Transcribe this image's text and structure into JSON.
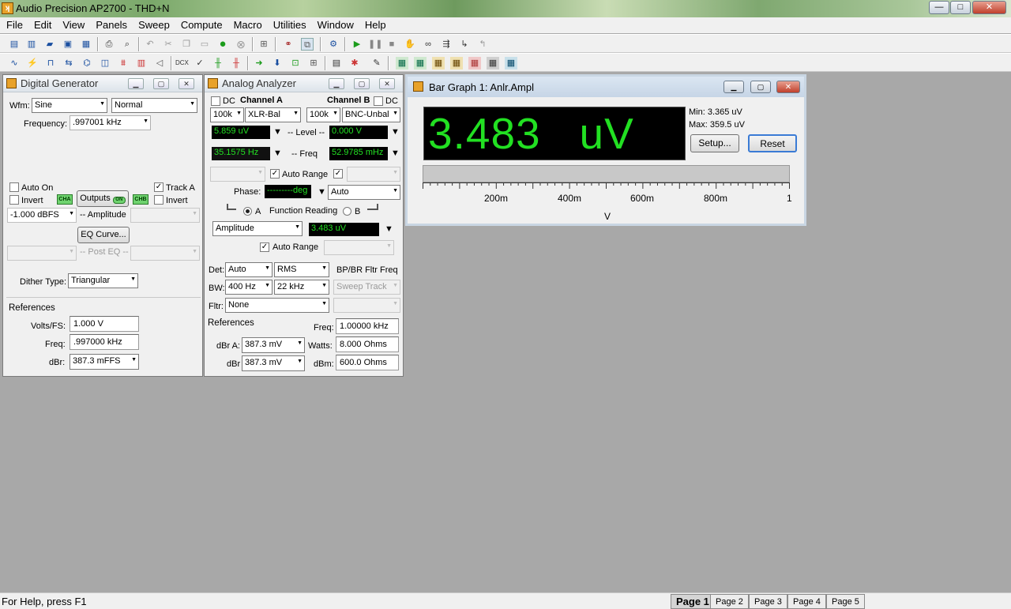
{
  "window": {
    "title": "Audio Precision AP2700 - THD+N",
    "controls": {
      "min": "—",
      "max": "□",
      "close": "✕"
    }
  },
  "menu": [
    "File",
    "Edit",
    "View",
    "Panels",
    "Sweep",
    "Compute",
    "Macro",
    "Utilities",
    "Window",
    "Help"
  ],
  "toolbar1_icons": [
    "new-icon",
    "new-test-icon",
    "open-icon",
    "save-icon",
    "save-all-icon",
    "print-icon",
    "print-preview-icon",
    "undo-icon",
    "cut-icon",
    "copy-icon",
    "paste-icon",
    "go-icon",
    "stop-circle-icon",
    "panel-icon",
    "link-icon",
    "link-toggle-icon",
    "settings-icon",
    "play-icon",
    "pause-icon",
    "stop-icon",
    "hand-icon",
    "binoculars-icon",
    "step-icon",
    "step-into-icon",
    "step-out-icon"
  ],
  "toolbar2_icons": [
    "waveform-icon",
    "analyzer-icon",
    "generator-icon",
    "switcher-icon",
    "dsp-icon",
    "sweep-icon",
    "filter-icon",
    "bargraph-icon",
    "speaker-icon",
    "dcx-icon",
    "check-icon",
    "level-icon",
    "balance-icon",
    "export-icon",
    "import-icon",
    "graph-icon",
    "table-icon",
    "meter-icon",
    "calibrate-icon",
    "notes-icon",
    "page-grid-1-icon",
    "page-grid-2-icon",
    "page-grid-3-icon",
    "page-grid-4-icon",
    "page-grid-5-icon",
    "page-grid-6-icon",
    "page-grid-7-icon"
  ],
  "gen": {
    "title": "Digital Generator",
    "wfm_label": "Wfm:",
    "wfm": "Sine",
    "wfm_mode": "Normal",
    "freq_label": "Frequency:",
    "freq": ".997001 kHz",
    "auto_on": "Auto On",
    "invert": "Invert",
    "track_a": "Track A",
    "invert_b": "Invert",
    "cha": "CHA",
    "chb": "CHB",
    "outputs": "Outputs",
    "outputs_state": "ON",
    "amp_value": "-1.000  dBFS",
    "amp_label": "-- Amplitude",
    "eq_curve": "EQ Curve...",
    "post_eq": "-- Post EQ --",
    "dither_label": "Dither Type:",
    "dither": "Triangular",
    "refs_label": "References",
    "volts_label": "Volts/FS:",
    "volts": "1.000   V",
    "freqref_label": "Freq:",
    "freqref": ".997000 kHz",
    "dbr_label": "dBr:",
    "dbr": "387.3   mFFS"
  },
  "anlr": {
    "title": "Analog Analyzer",
    "dc": "DC",
    "cha": "Channel A",
    "chb": "Channel B",
    "rng_a": "100k",
    "in_a": "XLR-Bal",
    "rng_b": "100k",
    "in_b": "BNC-Unbal",
    "level_a": "5.859   uV",
    "level_label": "-- Level --",
    "level_b": "0.000    V",
    "freq_a": "35.1575  Hz",
    "freq_label": "-- Freq",
    "freq_b": "52.9785 mHz",
    "auto_range": "Auto Range",
    "phase_label": "Phase:",
    "phase": "---------deg",
    "phase_mode": "Auto",
    "radio_a": "A",
    "func_label": "Function Reading",
    "radio_b": "B",
    "func": "Amplitude",
    "func_val": "3.483   uV",
    "auto_range2": "Auto Range",
    "det_label": "Det:",
    "det": "Auto",
    "det_mode": "RMS",
    "bpbr_label": "BP/BR Fltr Freq",
    "bw_label": "BW:",
    "bw_lo": "400 Hz",
    "bw_hi": "22 kHz",
    "sweep_track": "Sweep Track",
    "fltr_label": "Fltr:",
    "fltr": "None",
    "refs_label": "References",
    "freqref_label": "Freq:",
    "freqref": "1.00000 kHz",
    "dbra_label": "dBr A:",
    "dbra": "387.3   mV",
    "watts_label": "Watts:",
    "watts": "8.000    Ohms",
    "dbrb_label": "dBr",
    "dbrb": "387.3   mV",
    "dbm_label": "dBm:",
    "dbm": "600.0    Ohms"
  },
  "bar": {
    "title": "Bar Graph 1: Anlr.Ampl",
    "reading": "3.483   uV",
    "min": "Min: 3.365   uV",
    "max": "Max: 359.5   uV",
    "setup": "Setup...",
    "reset": "Reset",
    "value_fraction": 3.5e-06,
    "ticks": [
      "200m",
      "400m",
      "600m",
      "800m",
      "1"
    ],
    "unit": "V"
  },
  "status": {
    "help": "For Help, press F1",
    "pages": [
      "Page 1",
      "Page 2",
      "Page 3",
      "Page 4",
      "Page 5"
    ]
  }
}
